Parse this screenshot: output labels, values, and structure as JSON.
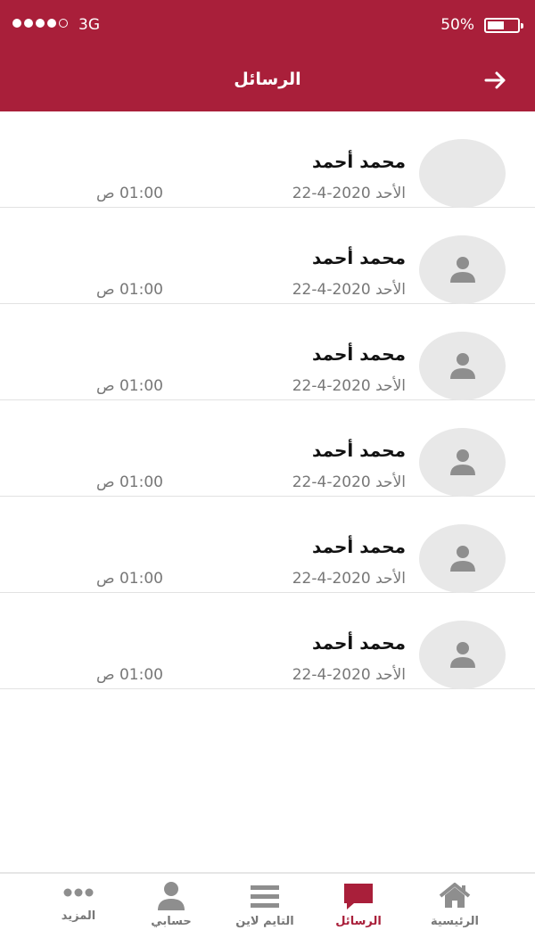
{
  "status_bar": {
    "network": "3G",
    "battery": "50%"
  },
  "header": {
    "title": "الرسائل"
  },
  "messages": [
    {
      "name": "محمد أحمد",
      "date": "الأحد 2020-4-22",
      "time": "01:00 ص"
    },
    {
      "name": "محمد أحمد",
      "date": "الأحد 2020-4-22",
      "time": "01:00 ص"
    },
    {
      "name": "محمد أحمد",
      "date": "الأحد 2020-4-22",
      "time": "01:00 ص"
    },
    {
      "name": "محمد أحمد",
      "date": "الأحد 2020-4-22",
      "time": "01:00 ص"
    },
    {
      "name": "محمد أحمد",
      "date": "الأحد 2020-4-22",
      "time": "01:00 ص"
    },
    {
      "name": "محمد أحمد",
      "date": "الأحد 2020-4-22",
      "time": "01:00 ص"
    }
  ],
  "tabs": [
    {
      "label": "الرئيسية",
      "icon": "home-icon",
      "active": false
    },
    {
      "label": "الرسائل",
      "icon": "chat-icon",
      "active": true
    },
    {
      "label": "التايم لاين",
      "icon": "menu-icon",
      "active": false
    },
    {
      "label": "حسابي",
      "icon": "person-icon",
      "active": false
    },
    {
      "label": "المزيد",
      "icon": "more-icon",
      "active": false
    }
  ],
  "colors": {
    "accent": "#a91f3a",
    "avatar_bg": "#e8e8e8",
    "icon_gray": "#8e8e8e"
  }
}
